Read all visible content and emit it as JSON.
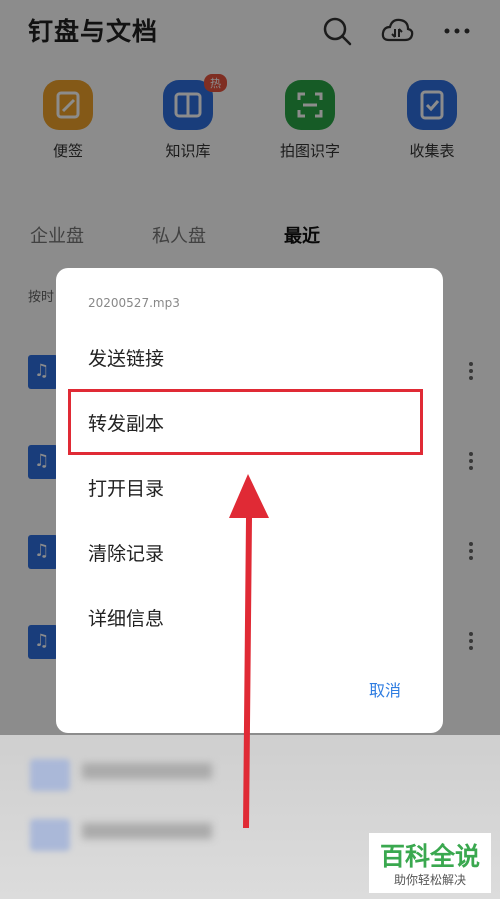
{
  "app": {
    "title": "钉盘与文档",
    "header_icons": [
      "search-icon",
      "cloud-transfer-icon",
      "more-icon"
    ],
    "tiles": [
      {
        "label": "便签",
        "color": "#f0a32a",
        "icon": "note-icon"
      },
      {
        "label": "知识库",
        "color": "#2f6fe0",
        "icon": "book-icon",
        "badge": "热"
      },
      {
        "label": "拍图识字",
        "color": "#28a745",
        "icon": "scan-icon"
      },
      {
        "label": "收集表",
        "color": "#2f6fe0",
        "icon": "form-icon"
      }
    ],
    "tabs": [
      {
        "label": "企业盘",
        "active": false
      },
      {
        "label": "私人盘",
        "active": false
      },
      {
        "label": "最近",
        "active": true
      }
    ],
    "sort_label": "按时"
  },
  "dialog": {
    "file_name": "20200527.mp3",
    "options": [
      "发送链接",
      "转发副本",
      "打开目录",
      "清除记录",
      "详细信息"
    ],
    "highlighted_option": "转发副本",
    "cancel_label": "取消"
  },
  "watermark": {
    "brand": "百科全说",
    "slogan": "助你轻松解决"
  },
  "colors": {
    "accent_blue": "#2f7de1",
    "highlight_red": "#e02a35",
    "watermark_green": "#3aa84f"
  }
}
